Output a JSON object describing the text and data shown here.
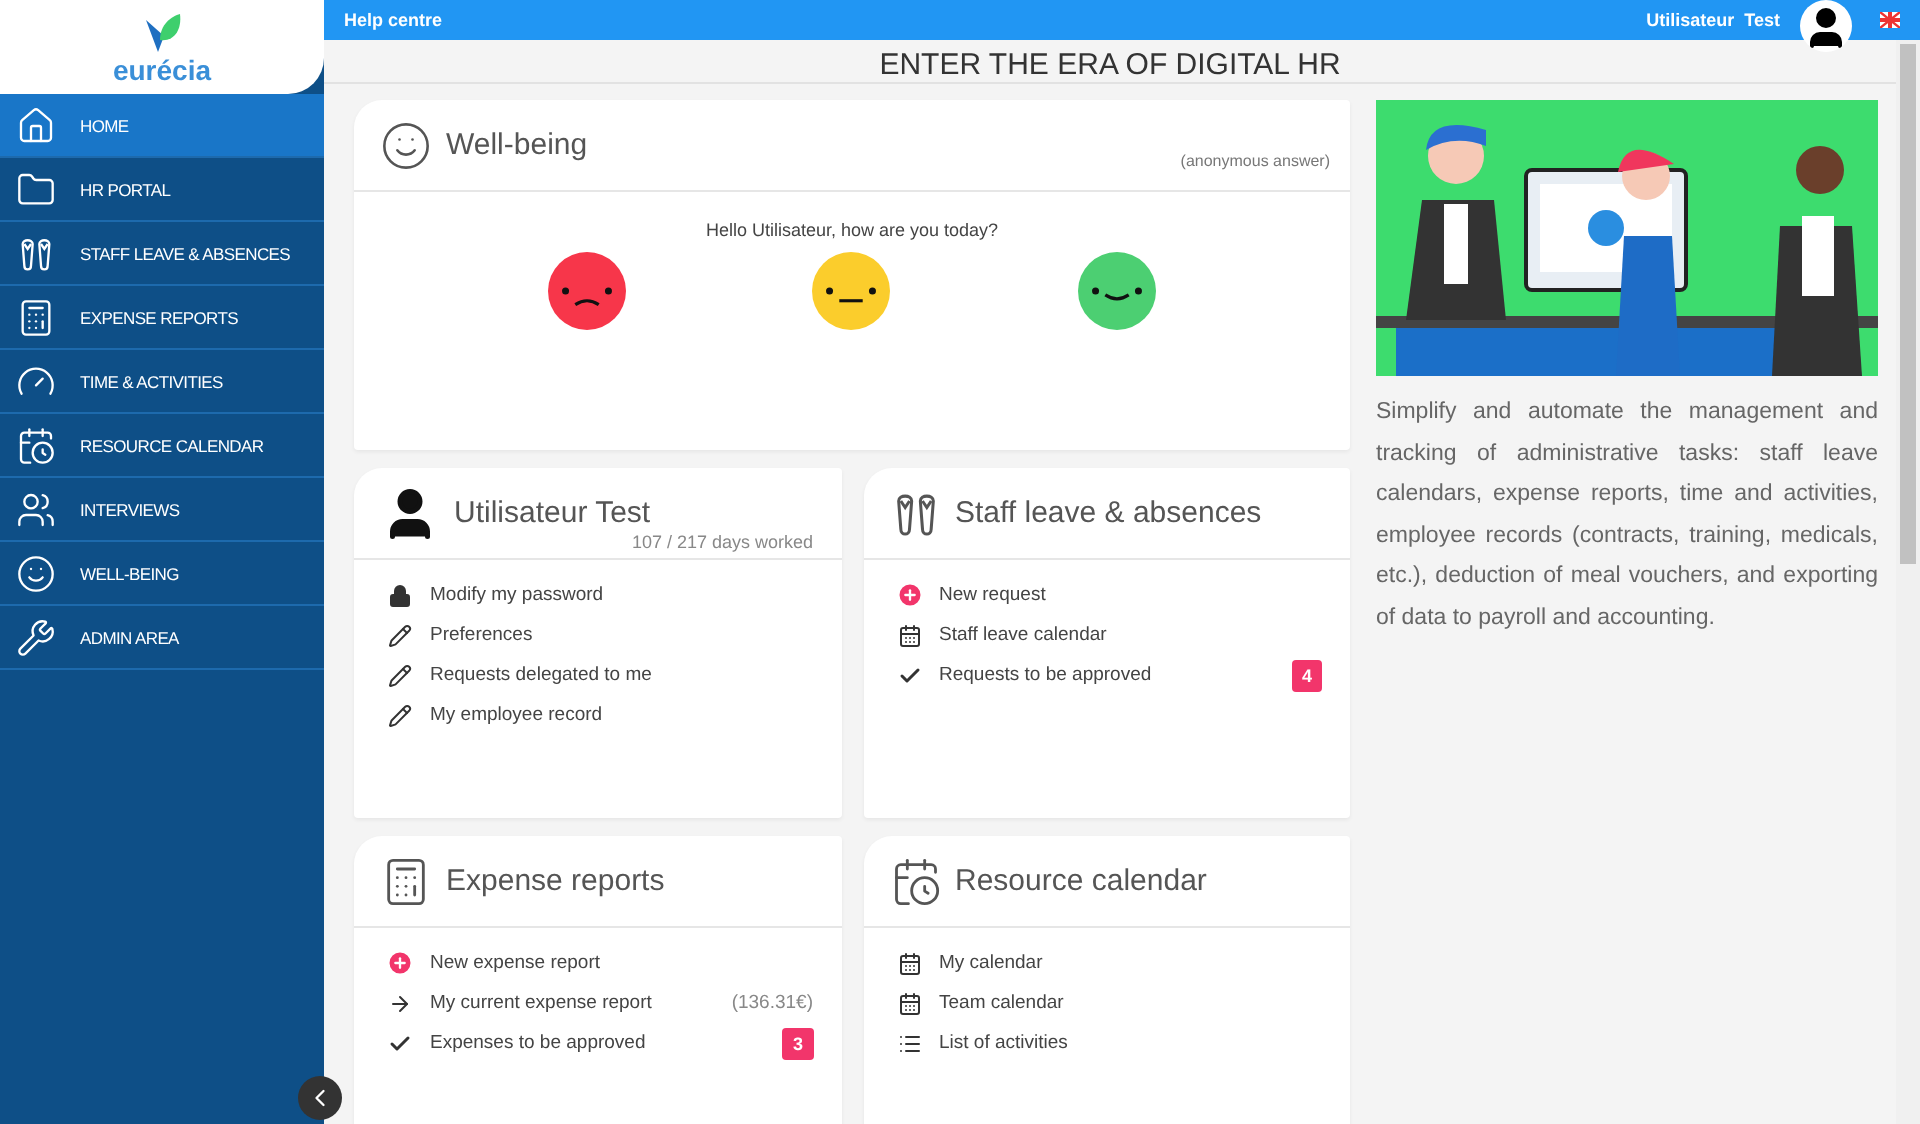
{
  "logo": {
    "text": "eurécia"
  },
  "sidebar": {
    "items": [
      {
        "label": "HOME",
        "kind": "home",
        "selected": true
      },
      {
        "label": "HR PORTAL",
        "kind": "folder",
        "selected": false
      },
      {
        "label": "STAFF LEAVE & ABSENCES",
        "kind": "flipflops",
        "selected": false
      },
      {
        "label": "EXPENSE REPORTS",
        "kind": "calculator",
        "selected": false
      },
      {
        "label": "TIME & ACTIVITIES",
        "kind": "gauge",
        "selected": false
      },
      {
        "label": "RESOURCE CALENDAR",
        "kind": "calendar",
        "selected": false
      },
      {
        "label": "INTERVIEWS",
        "kind": "people",
        "selected": false
      },
      {
        "label": "WELL-BEING",
        "kind": "smile",
        "selected": false
      },
      {
        "label": "ADMIN AREA",
        "kind": "wrench",
        "selected": false
      }
    ]
  },
  "topbar": {
    "help": "Help centre",
    "user": "Utilisateur  Test"
  },
  "page_title": "ENTER THE ERA OF DIGITAL HR",
  "wellbeing": {
    "title": "Well-being",
    "note": "(anonymous answer)",
    "question": "Hello Utilisateur, how are you today?",
    "moods": [
      {
        "kind": "sad",
        "color": "#f7364a"
      },
      {
        "kind": "neutral",
        "color": "#fbcd2c"
      },
      {
        "kind": "happy",
        "color": "#4ccf72"
      }
    ]
  },
  "cards": [
    {
      "kind": "user",
      "title": "Utilisateur Test",
      "subtitle": "107 / 217 days worked",
      "items": [
        {
          "kind": "lock",
          "label": "Modify my password"
        },
        {
          "kind": "edit",
          "label": "Preferences"
        },
        {
          "kind": "edit",
          "label": "Requests delegated to me"
        },
        {
          "kind": "edit",
          "label": "My employee record"
        }
      ]
    },
    {
      "kind": "leave",
      "title": "Staff leave & absences",
      "items": [
        {
          "kind": "add",
          "label": "New request"
        },
        {
          "kind": "calendar",
          "label": "Staff leave calendar"
        },
        {
          "kind": "check",
          "label": "Requests to be approved",
          "badge": "4"
        }
      ]
    },
    {
      "kind": "expense",
      "title": "Expense reports",
      "items": [
        {
          "kind": "add",
          "label": "New expense report"
        },
        {
          "kind": "arrow",
          "label": "My current expense report",
          "amount": "(136.31€)"
        },
        {
          "kind": "check",
          "label": "Expenses to be approved",
          "badge": "3"
        }
      ]
    },
    {
      "kind": "calendar",
      "title": "Resource calendar",
      "items": [
        {
          "kind": "calendar",
          "label": "My calendar"
        },
        {
          "kind": "calendar",
          "label": "Team calendar"
        },
        {
          "kind": "list",
          "label": "List of activities"
        }
      ]
    }
  ],
  "promo": {
    "text": "Simplify and automate the management and tracking of administrative tasks: staff leave calendars, expense reports, time and activities, employee records (contracts, training, medicals, etc.), deduction of meal vouchers, and exporting of data to payroll and accounting."
  }
}
